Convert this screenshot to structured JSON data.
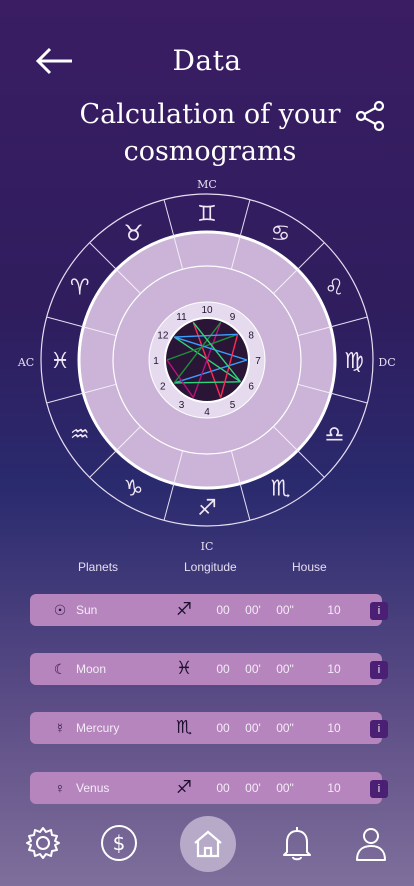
{
  "header": {
    "title": "Data",
    "subtitle": "Calculation of your cosmograms"
  },
  "wheel": {
    "axis_labels": {
      "mc": "MC",
      "ic": "IC",
      "ac": "AC",
      "dc": "DC"
    },
    "zodiac_signs": [
      "♉",
      "♊",
      "♋",
      "♌",
      "♍",
      "♎",
      "♏",
      "♐",
      "♑",
      "♒",
      "♓",
      "♈"
    ],
    "house_numbers": [
      "10",
      "9",
      "8",
      "7",
      "6",
      "5",
      "4",
      "3",
      "2",
      "1",
      "12",
      "11"
    ]
  },
  "table": {
    "col_planets": "Planets",
    "col_longitude": "Longitude",
    "col_house": "House",
    "rows": [
      {
        "planet_icon": "sun-icon",
        "planet_symbol": "☉",
        "planet": "Sun",
        "sign_symbol": "♐",
        "deg": "00",
        "min": "00'",
        "sec": "00\"",
        "house": "10",
        "info": "i"
      },
      {
        "planet_icon": "moon-icon",
        "planet_symbol": "☾",
        "planet": "Moon",
        "sign_symbol": "♓",
        "deg": "00",
        "min": "00'",
        "sec": "00\"",
        "house": "10",
        "info": "i"
      },
      {
        "planet_icon": "mercury-icon",
        "planet_symbol": "☿",
        "planet": "Mercury",
        "sign_symbol": "♏",
        "deg": "00",
        "min": "00'",
        "sec": "00\"",
        "house": "10",
        "info": "i"
      },
      {
        "planet_icon": "venus-icon",
        "planet_symbol": "♀",
        "planet": "Venus",
        "sign_symbol": "♐",
        "deg": "00",
        "min": "00'",
        "sec": "00\"",
        "house": "10",
        "info": "i"
      }
    ]
  },
  "nav": {
    "items": [
      "settings-icon",
      "dollar-icon",
      "home-icon",
      "bell-icon",
      "profile-icon"
    ]
  },
  "colors": {
    "row_bg": "#b685bd",
    "info_bg": "#4b1f74",
    "wheel_inner": "#cbb4d8"
  }
}
